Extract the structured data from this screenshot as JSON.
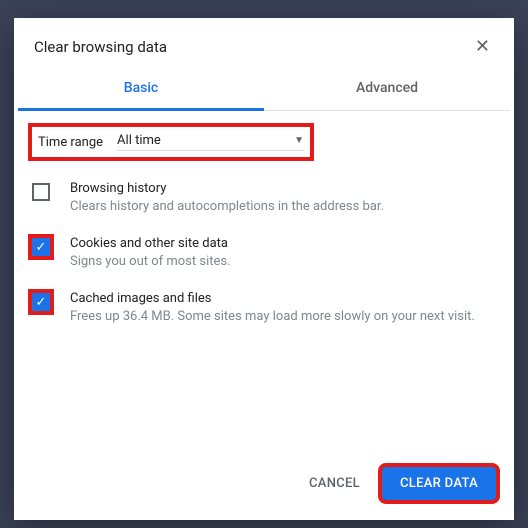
{
  "dialog": {
    "title": "Clear browsing data",
    "tabs": {
      "basic": "Basic",
      "advanced": "Advanced"
    },
    "timeRange": {
      "label": "Time range",
      "value": "All time"
    },
    "options": [
      {
        "title": "Browsing history",
        "desc": "Clears history and autocompletions in the address bar.",
        "checked": false,
        "highlight": false
      },
      {
        "title": "Cookies and other site data",
        "desc": "Signs you out of most sites.",
        "checked": true,
        "highlight": true
      },
      {
        "title": "Cached images and files",
        "desc": "Frees up 36.4 MB. Some sites may load more slowly on your next visit.",
        "checked": true,
        "highlight": true
      }
    ],
    "buttons": {
      "cancel": "CANCEL",
      "clear": "CLEAR DATA"
    }
  }
}
